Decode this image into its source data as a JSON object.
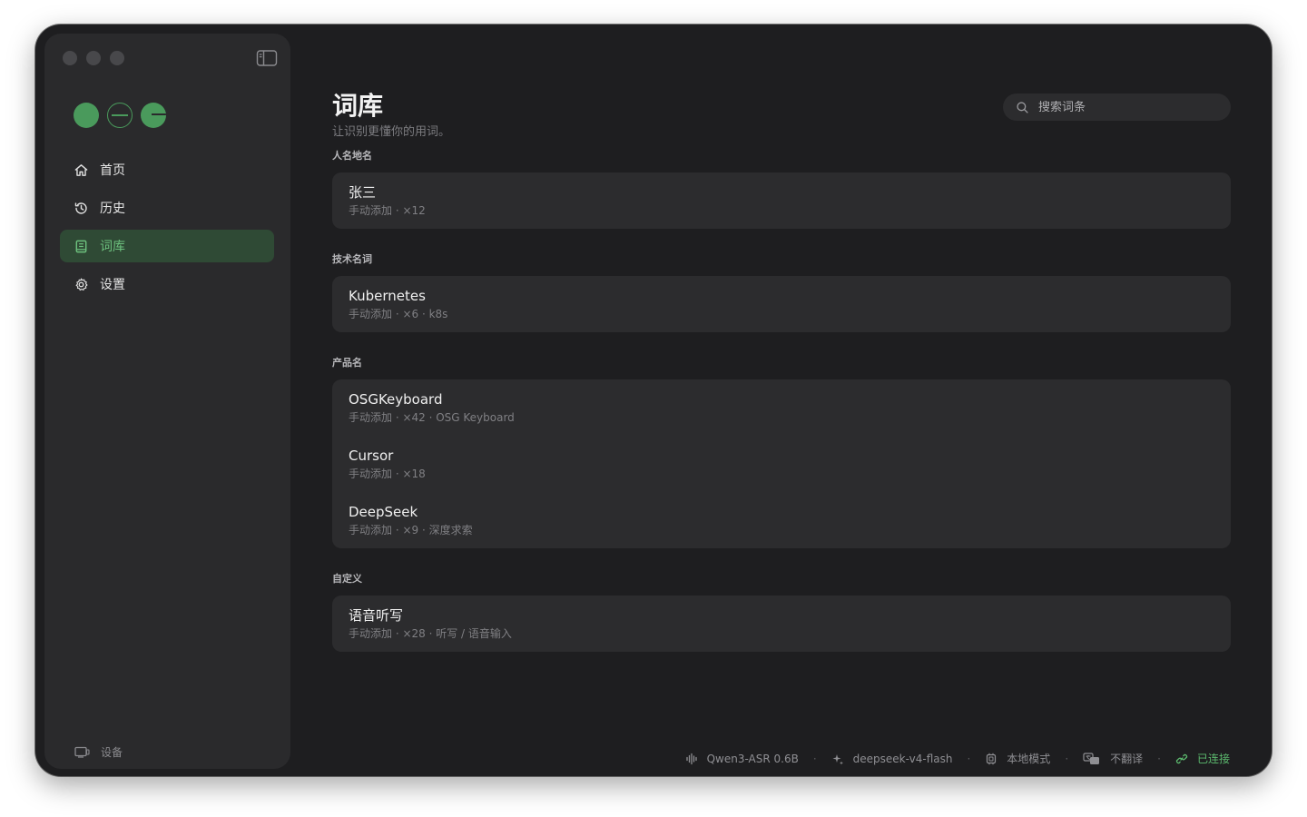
{
  "sidebar": {
    "items": [
      {
        "label": "首页",
        "icon": "home-icon"
      },
      {
        "label": "历史",
        "icon": "history-icon"
      },
      {
        "label": "词库",
        "icon": "book-icon",
        "active": true
      },
      {
        "label": "设置",
        "icon": "gear-icon"
      }
    ],
    "device_label": "设备"
  },
  "header": {
    "title": "词库",
    "subtitle": "让识别更懂你的用词。"
  },
  "search": {
    "placeholder": "搜索词条"
  },
  "sections": [
    {
      "label": "人名地名",
      "entries": [
        {
          "term": "张三",
          "meta": "手动添加 · ×12"
        }
      ]
    },
    {
      "label": "技术名词",
      "entries": [
        {
          "term": "Kubernetes",
          "meta": "手动添加 · ×6 · k8s"
        }
      ]
    },
    {
      "label": "产品名",
      "entries": [
        {
          "term": "OSGKeyboard",
          "meta": "手动添加 · ×42 · OSG Keyboard"
        },
        {
          "term": "Cursor",
          "meta": "手动添加 · ×18"
        },
        {
          "term": "DeepSeek",
          "meta": "手动添加 · ×9 · 深度求索"
        }
      ]
    },
    {
      "label": "自定义",
      "entries": [
        {
          "term": "语音听写",
          "meta": "手动添加 · ×28 · 听写 / 语音输入"
        }
      ]
    }
  ],
  "status": {
    "asr_model": "Qwen3-ASR 0.6B",
    "llm_model": "deepseek-v4-flash",
    "mode": "本地模式",
    "translate": "不翻译",
    "connection": "已连接",
    "separator": "·"
  },
  "colors": {
    "accent": "#4a9a5c",
    "accent_text": "#6dc17e",
    "active_bg": "#2f4a35",
    "window_bg": "#1e1e20",
    "sidebar_bg": "#2a2a2c",
    "card_bg": "#2c2c2e"
  }
}
